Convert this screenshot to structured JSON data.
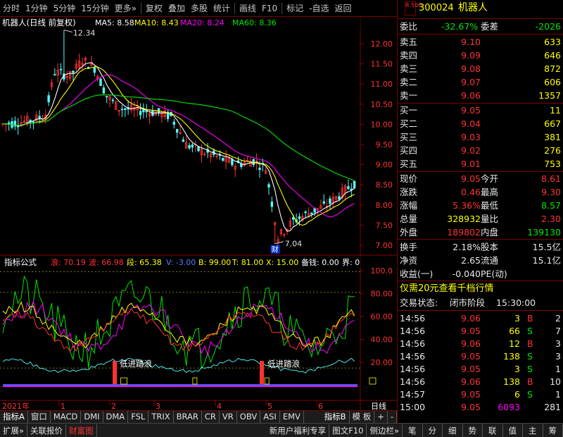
{
  "toolbar": {
    "items": [
      "分时",
      "1分钟",
      "5分钟",
      "15分钟",
      "更多»",
      "复权",
      "叠加",
      "多股",
      "统计",
      "画线",
      "F10",
      "标记",
      "-自选",
      "返回"
    ]
  },
  "main_chart": {
    "title": "机器人(日线 前复权)",
    "ma5": "MA5: 8.58",
    "ma10": "MA10: 8.43",
    "ma20": "MA20: 8.24",
    "ma60": "MA60: 8.36",
    "high_label": "12.34",
    "low_label": "7.04",
    "cai_tag": "财",
    "price_ticks": [
      "12.00",
      "11.50",
      "11.00",
      "10.50",
      "10.00",
      "9.50",
      "9.00",
      "8.50",
      "8.00",
      "7.50",
      "7.00"
    ]
  },
  "indicator": {
    "name": "指标公式",
    "lang": "浪: 70.19",
    "bo": "波: 66.98",
    "duan": "段: 65.38",
    "V": "V: -3.00",
    "B": "B: 99.00",
    "T": "T: 81.00",
    "X": "X: 15.00",
    "beiqian": "备钱: 0.00",
    "jie": "界: 0",
    "ticks": [
      "100.0",
      "80.00",
      "60.00",
      "40.00",
      "20.00"
    ],
    "signal_label": "低进踏浪"
  },
  "xaxis": {
    "labels": [
      "2021年",
      "1",
      "2",
      "3",
      "4",
      "5",
      "6"
    ],
    "period": "日线"
  },
  "tabs": [
    "指标A",
    "窗口",
    "MACD",
    "DMI",
    "DMA",
    "FSL",
    "TRIX",
    "BRAR",
    "CR",
    "VR",
    "OBV",
    "ASI",
    "EMV",
    "指标B",
    "模 板",
    "+",
    "-"
  ],
  "statusbar": {
    "items": [
      "扩展»",
      "关联报价",
      "财富图",
      "新用户福利专享",
      "图文F10",
      "侧边栏»",
      "笔",
      "分",
      "细",
      "势",
      "联",
      "值",
      "主",
      "筹"
    ]
  },
  "quote": {
    "badge": "R 500",
    "code": "300024",
    "name": "机器人",
    "weibi_label": "委比",
    "weibi": "-32.67%",
    "weicha_label": "委差",
    "weicha": "-2026",
    "asks": [
      {
        "label": "卖五",
        "price": "9.10",
        "vol": "633"
      },
      {
        "label": "卖四",
        "price": "9.09",
        "vol": "646"
      },
      {
        "label": "卖三",
        "price": "9.08",
        "vol": "872"
      },
      {
        "label": "卖二",
        "price": "9.07",
        "vol": "606"
      },
      {
        "label": "卖一",
        "price": "9.06",
        "vol": "1357"
      }
    ],
    "bids": [
      {
        "label": "买一",
        "price": "9.05",
        "vol": "11"
      },
      {
        "label": "买二",
        "price": "9.04",
        "vol": "667"
      },
      {
        "label": "买三",
        "price": "9.03",
        "vol": "381"
      },
      {
        "label": "买四",
        "price": "9.02",
        "vol": "276"
      },
      {
        "label": "买五",
        "price": "9.01",
        "vol": "753"
      }
    ],
    "stats": [
      {
        "l1": "现价",
        "v1": "9.05",
        "l2": "今开",
        "v2": "8.61"
      },
      {
        "l1": "涨跌",
        "v1": "0.46",
        "l2": "最高",
        "v2": "9.30"
      },
      {
        "l1": "涨幅",
        "v1": "5.36%",
        "l2": "最低",
        "v2": "8.57"
      },
      {
        "l1": "总量",
        "v1": "328932",
        "l2": "量比",
        "v2": "2.30"
      },
      {
        "l1": "外盘",
        "v1": "189802",
        "l2": "内盘",
        "v2": "139130"
      }
    ],
    "stats2": [
      {
        "l1": "换手",
        "v1": "2.18%",
        "l2": "股本",
        "v2": "15.5亿"
      },
      {
        "l1": "净资",
        "v1": "2.65",
        "l2": "流通",
        "v2": "15.1亿"
      },
      {
        "l1": "收益(一)",
        "v1": "-0.040",
        "l2": "PE(动)",
        "v2": ""
      }
    ],
    "promo": "仅需20元查看千档行情",
    "trade_state_label": "交易状态:",
    "trade_state": "闭市阶段",
    "trade_time": "15:30:00",
    "ticks": [
      {
        "t": "14:56",
        "p": "9.06",
        "v": "3",
        "d": "B",
        "n": "2"
      },
      {
        "t": "14:56",
        "p": "9.05",
        "v": "66",
        "d": "S",
        "n": "7"
      },
      {
        "t": "14:56",
        "p": "9.06",
        "v": "12",
        "d": "B",
        "n": "3"
      },
      {
        "t": "14:56",
        "p": "9.05",
        "v": "138",
        "d": "S",
        "n": "3"
      },
      {
        "t": "14:56",
        "p": "9.05",
        "v": "3",
        "d": "S",
        "n": "1"
      },
      {
        "t": "14:56",
        "p": "9.06",
        "v": "138",
        "d": "B",
        "n": "10"
      },
      {
        "t": "14:57",
        "p": "9.05",
        "v": "6",
        "d": "S",
        "n": "1"
      },
      {
        "t": "15:00",
        "p": "9.05",
        "v": "6093",
        "d": "",
        "n": "281"
      }
    ]
  }
}
